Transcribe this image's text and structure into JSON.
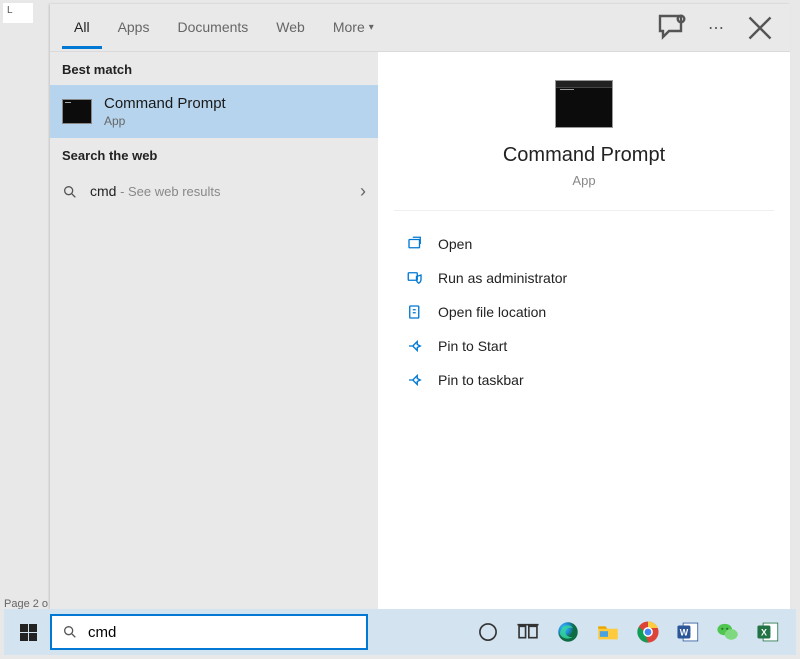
{
  "bg": {
    "corner": "L",
    "status": "Page 2 o"
  },
  "tabs": {
    "all": "All",
    "apps": "Apps",
    "documents": "Documents",
    "web": "Web",
    "more": "More"
  },
  "sections": {
    "best_match": "Best match",
    "search_web": "Search the web"
  },
  "best_match": {
    "title": "Command Prompt",
    "subtitle": "App"
  },
  "web_result": {
    "query": "cmd",
    "hint": " - See web results"
  },
  "detail": {
    "title": "Command Prompt",
    "subtitle": "App",
    "actions": {
      "open": "Open",
      "run_admin": "Run as administrator",
      "open_loc": "Open file location",
      "pin_start": "Pin to Start",
      "pin_taskbar": "Pin to taskbar"
    }
  },
  "search": {
    "value": "cmd"
  },
  "colors": {
    "accent": "#0078d4"
  }
}
